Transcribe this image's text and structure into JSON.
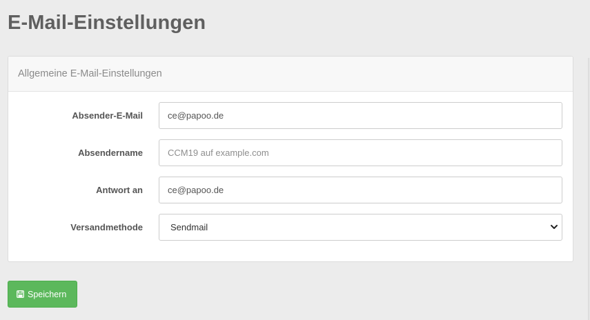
{
  "page": {
    "title": "E-Mail-Einstellungen"
  },
  "panel": {
    "heading": "Allgemeine E-Mail-Einstellungen"
  },
  "form": {
    "sender_email": {
      "label": "Absender-E-Mail",
      "value": "ce@papoo.de"
    },
    "sender_name": {
      "label": "Absendername",
      "value": "",
      "placeholder": "CCM19 auf example.com"
    },
    "reply_to": {
      "label": "Antwort an",
      "value": "ce@papoo.de"
    },
    "send_method": {
      "label": "Versandmethode",
      "selected": "Sendmail"
    }
  },
  "actions": {
    "save_label": "Speichern",
    "save_icon": "floppy-disk-icon"
  },
  "colors": {
    "background": "#ececec",
    "title": "#5f5f5f",
    "panel_heading_bg": "#f8f8f8",
    "save_button": "#5cb85c"
  }
}
